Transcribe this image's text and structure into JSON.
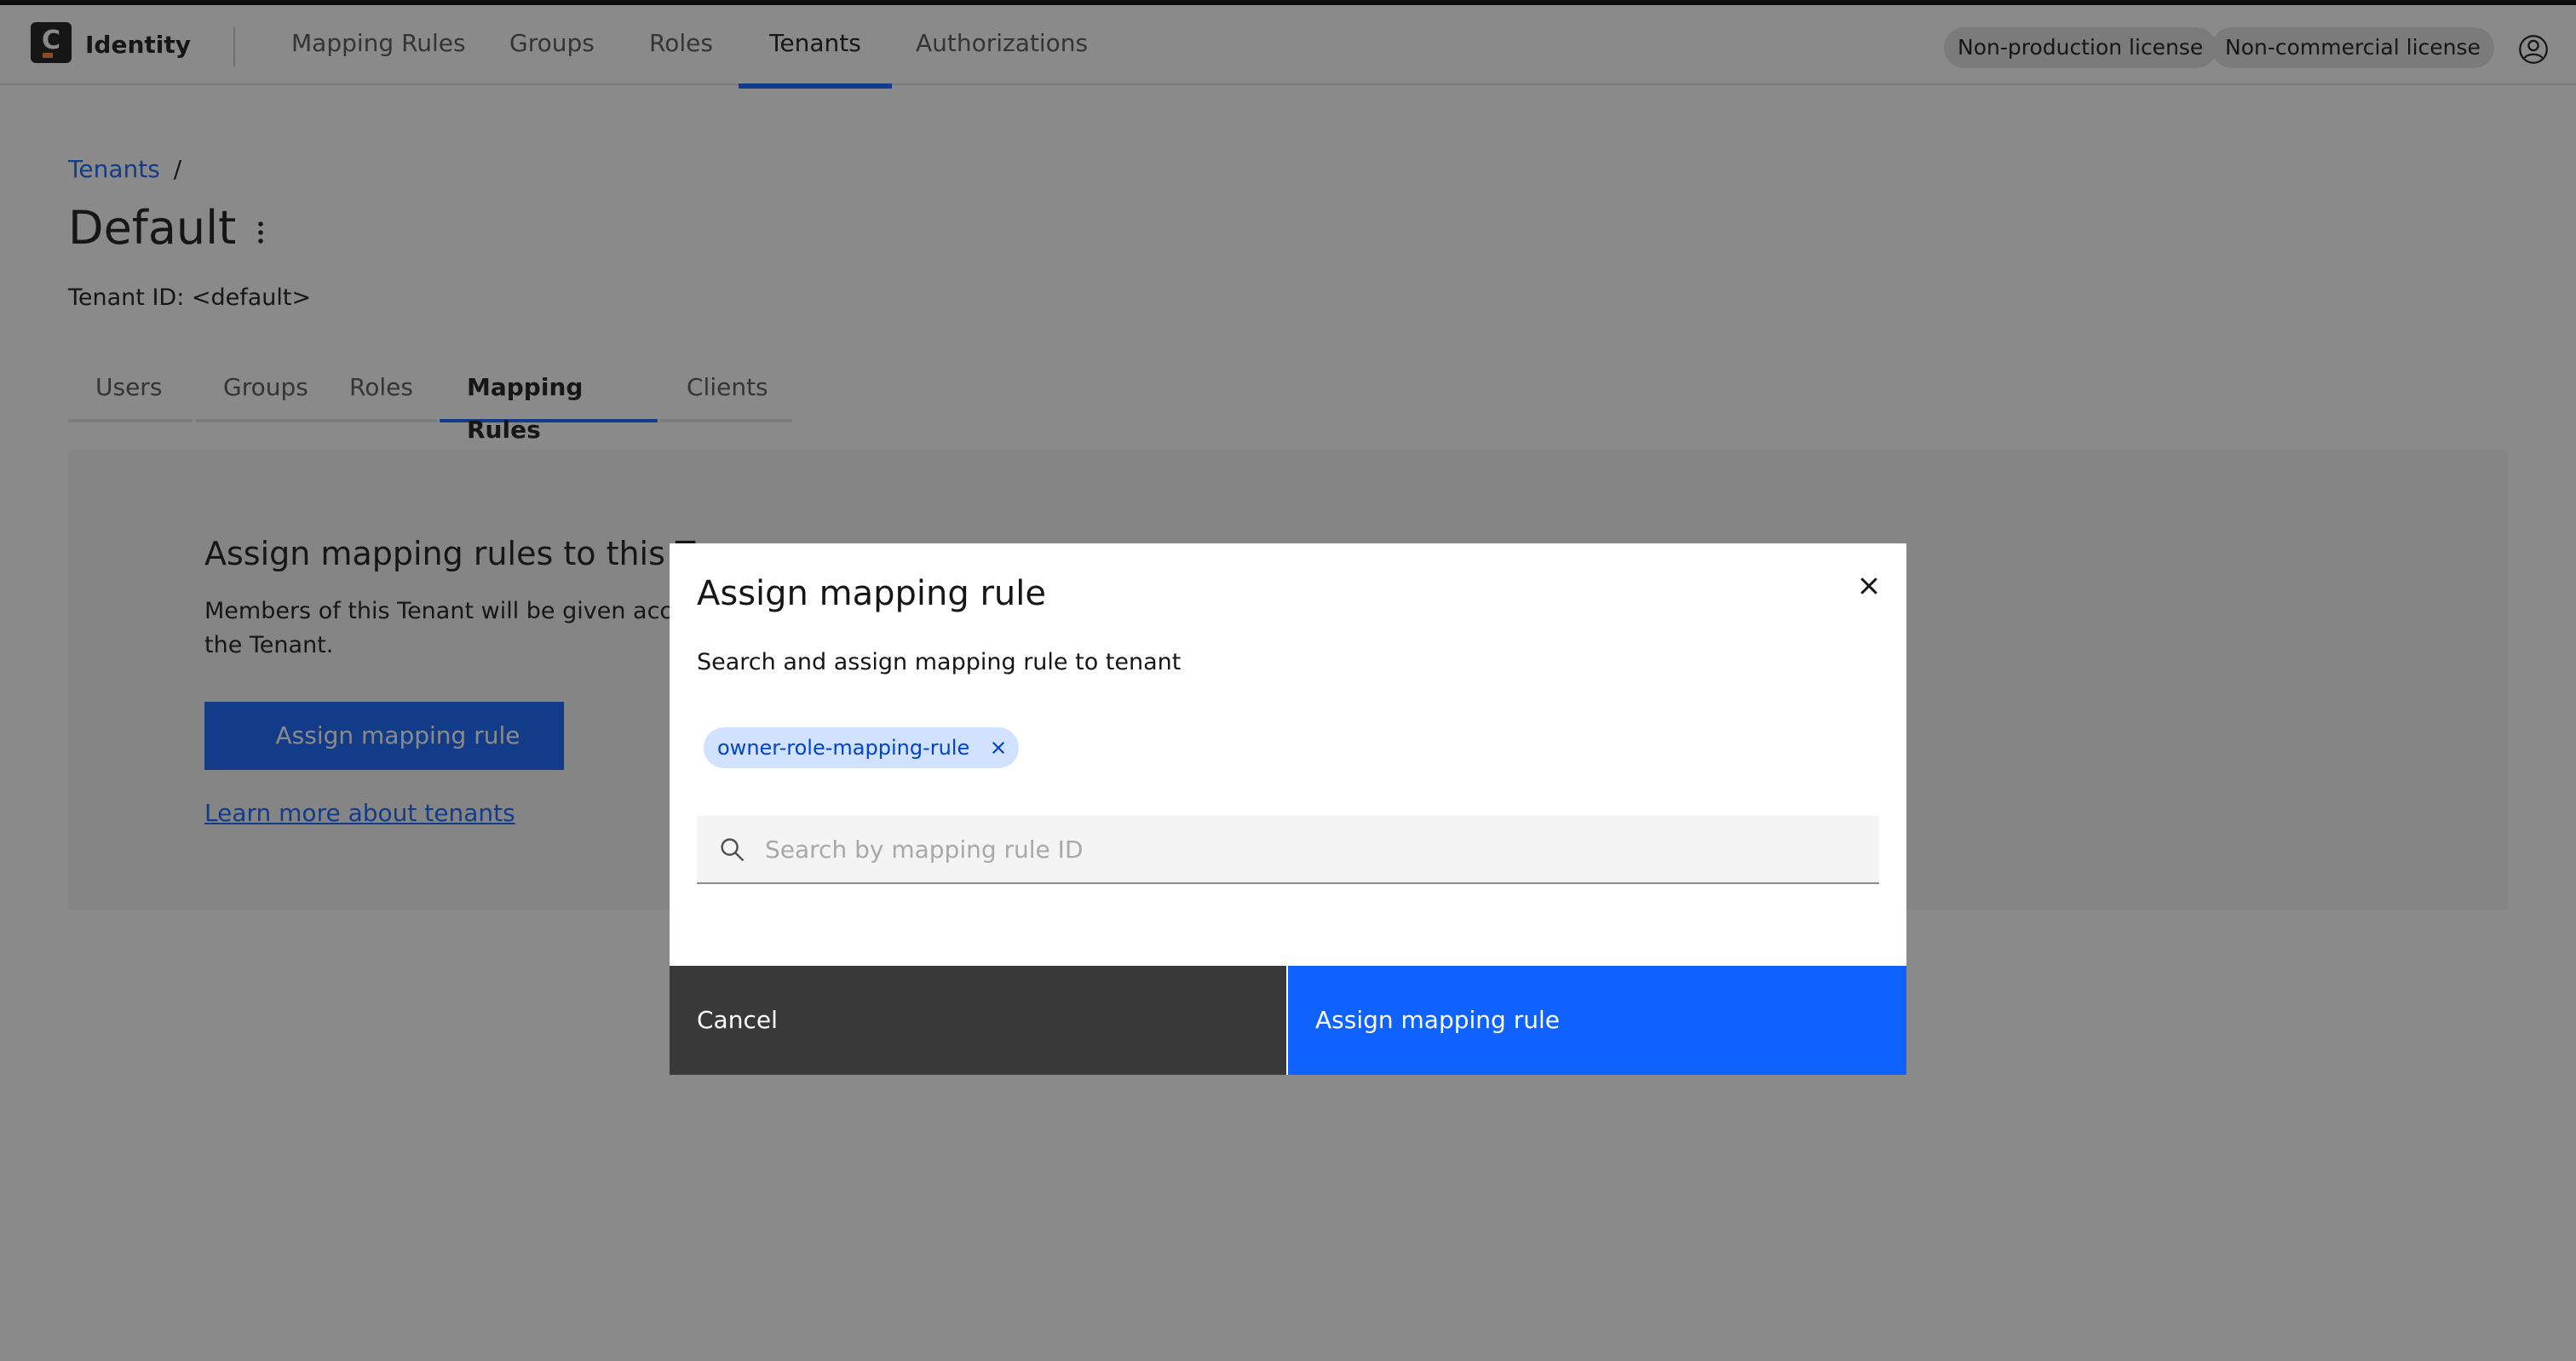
{
  "header": {
    "logo_letter": "C",
    "app_name": "Identity",
    "nav": [
      {
        "label": "Mapping Rules",
        "active": false
      },
      {
        "label": "Groups",
        "active": false
      },
      {
        "label": "Roles",
        "active": false
      },
      {
        "label": "Tenants",
        "active": true
      },
      {
        "label": "Authorizations",
        "active": false
      }
    ],
    "licenses": [
      "Non-production license",
      "Non-commercial license"
    ],
    "user_icon": "user-avatar-icon"
  },
  "page": {
    "breadcrumb": {
      "link": "Tenants",
      "separator": "/"
    },
    "title": "Default",
    "tenant_id": "Tenant ID: <default>",
    "tabs": [
      {
        "label": "Users",
        "active": false
      },
      {
        "label": "Groups",
        "active": false
      },
      {
        "label": "Roles",
        "active": false
      },
      {
        "label": "Mapping Rules",
        "active": true
      },
      {
        "label": "Clients",
        "active": false
      }
    ],
    "empty_state": {
      "title": "Assign mapping rules to this Te",
      "description": "Members of this Tenant will be given acces the Tenant.",
      "button": "Assign mapping rule",
      "link": "Learn more about tenants"
    }
  },
  "modal": {
    "title": "Assign mapping rule",
    "subtitle": "Search and assign mapping rule to tenant",
    "selected_tag": "owner-role-mapping-rule",
    "search": {
      "value": "",
      "placeholder": "Search by mapping rule ID"
    },
    "cancel_label": "Cancel",
    "submit_label": "Assign mapping rule"
  },
  "colors": {
    "accent": "#0f62fe",
    "tag_bg": "#d0e2ff",
    "secondary_button": "#393939",
    "overlay": "rgba(22,22,22,0.5)"
  }
}
